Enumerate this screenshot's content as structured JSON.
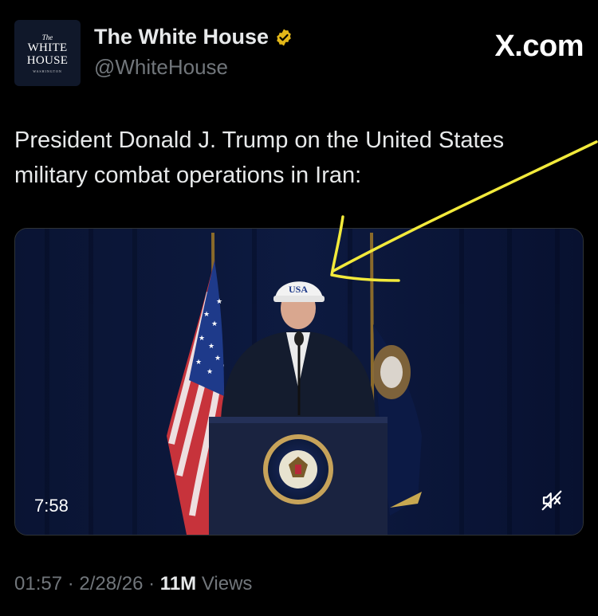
{
  "account": {
    "display_name": "The White House",
    "handle": "@WhiteHouse",
    "verified_badge_icon": "gold-verified-badge-icon",
    "avatar": {
      "line1": "The",
      "line2": "WHITE",
      "line3": "HOUSE",
      "line4": "WASHINGTON"
    }
  },
  "source_label": "X.com",
  "tweet": {
    "text": "President Donald J. Trump on the United States military combat operations in Iran:"
  },
  "media": {
    "duration": "7:58",
    "mute_icon": "muted-speaker-icon",
    "hat_text": "USA"
  },
  "meta": {
    "time": "01:57",
    "sep1": " · ",
    "date": "2/28/26",
    "sep2": " · ",
    "views_count": "11M",
    "views_label": " Views"
  },
  "colors": {
    "background": "#000000",
    "text_primary": "#e7e9ea",
    "text_secondary": "#71767b",
    "badge_gold": "#e2b719",
    "annotation_yellow": "#f2ea3b"
  }
}
